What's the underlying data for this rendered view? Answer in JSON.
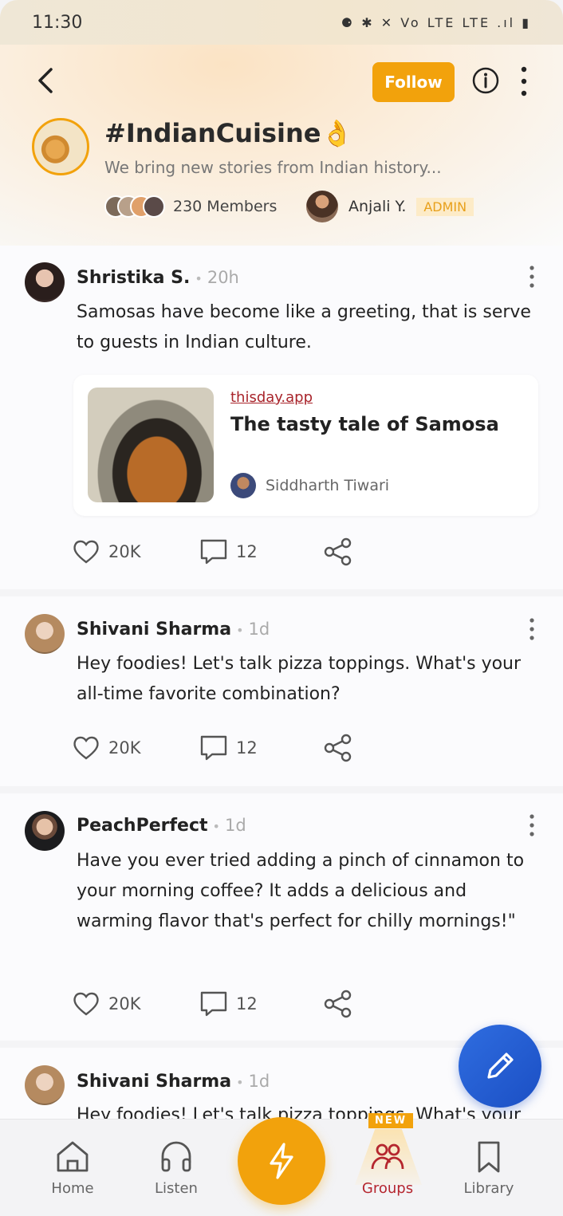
{
  "status_bar": {
    "time": "11:30",
    "icons": "⚈ ✱ ✕ Vo LTE LTE .ıl ▮"
  },
  "header": {
    "follow_label": "Follow",
    "title": "#IndianCuisine👌",
    "description": "We bring new stories from Indian history...",
    "members_label": "230 Members",
    "admin_name": "Anjali Y.",
    "admin_badge": "ADMIN"
  },
  "posts": [
    {
      "author": "Shristika S.",
      "time": "20h",
      "text": "Samosas have become like a greeting, that is serve to guests in Indian culture.",
      "link": {
        "source": "thisday.app",
        "title": "The tasty tale of Samosa",
        "byline": "Siddharth Tiwari"
      },
      "likes": "20K",
      "comments": "12"
    },
    {
      "author": "Shivani Sharma",
      "time": "1d",
      "text": "Hey foodies! Let's talk pizza toppings. What's your all-time favorite combination?",
      "likes": "20K",
      "comments": "12"
    },
    {
      "author": "PeachPerfect",
      "time": "1d",
      "text": "Have you ever tried adding a pinch of cinnamon to your morning coffee? It adds a delicious and warming flavor that's perfect for chilly mornings!\"",
      "likes": "20K",
      "comments": "12"
    },
    {
      "author": "Shivani Sharma",
      "time": "1d",
      "text": "Hey foodies! Let's talk pizza toppings. What's your all-time favorite combination?"
    }
  ],
  "nav": {
    "home": "Home",
    "listen": "Listen",
    "groups": "Groups",
    "library": "Library",
    "new_badge": "NEW"
  },
  "colors": {
    "accent": "#f2a20c",
    "active_nav": "#b5262e",
    "fab": "#2f6de0"
  }
}
